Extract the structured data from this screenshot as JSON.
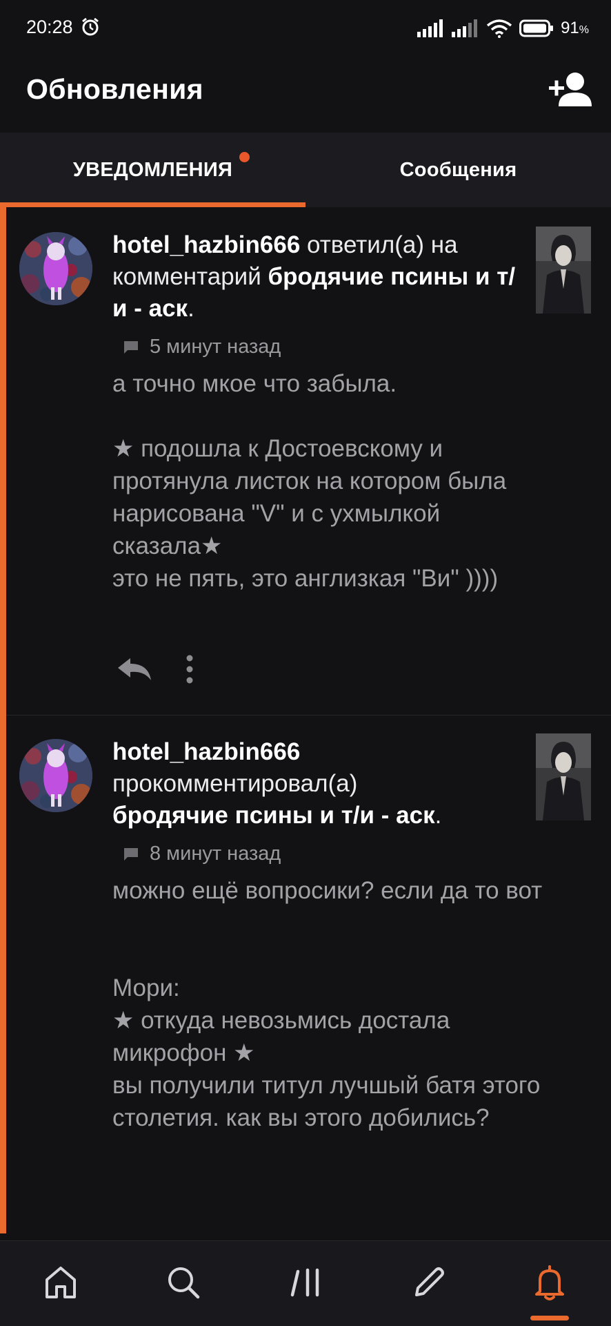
{
  "status_bar": {
    "time": "20:28",
    "battery_percent": "91",
    "battery_unit": "%"
  },
  "header": {
    "title": "Обновления",
    "add_user_icon": "person-add-icon"
  },
  "tabs": [
    {
      "label": "УВЕДОМЛЕНИЯ",
      "active": true,
      "has_dot": true
    },
    {
      "label": "Сообщения",
      "active": false
    }
  ],
  "notifications": [
    {
      "user": "hotel_hazbin666",
      "action": "ответил(а) на комментарий",
      "story": "бродячие псины и т/и - аск",
      "time": "5 минут назад",
      "body": "а точно мкое что забыла.\n\n★ подошла к Достоевскому и протянула листок на котором была нарисована \"V\" и с ухмылкой сказала★\nэто не пять, это англизкая \"Ви\" ))))"
    },
    {
      "user": "hotel_hazbin666",
      "action": "прокомментировал(а)",
      "story": "бродячие псины и т/и - аск",
      "time": "8 минут назад",
      "body": "можно ещё вопросики? если да то вот\n\n\nМори:\n★ откуда невозьмись достала микрофон ★\nвы получили титул лучшый батя этого столетия. как вы этого добились?"
    }
  ],
  "nav": {
    "items": [
      "home-icon",
      "search-icon",
      "library-icon",
      "write-icon",
      "notifications-bell-icon"
    ],
    "active": "notifications-bell-icon"
  },
  "colors": {
    "accent": "#ea6a2e",
    "background": "#121114",
    "tab_bar": "#1c1b1f"
  }
}
